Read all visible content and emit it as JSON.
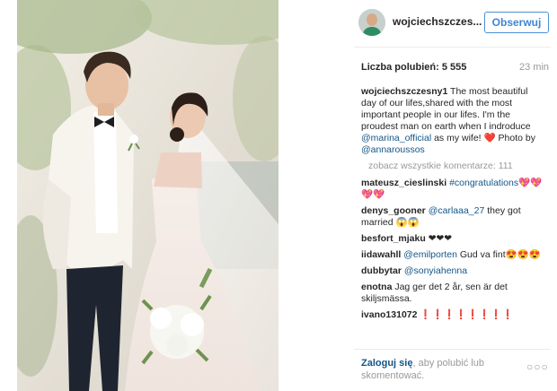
{
  "post": {
    "username": "wojciechszczes...",
    "follow_label": "Obserwuj",
    "likes": "Liczba polubień: 5 555",
    "time": "23 min"
  },
  "caption": {
    "user": "wojciechszczesny1",
    "text_1": " The most beautiful day of our lifes,shared with the most important people in our lifes. I'm the proudest man on earth when I indroduce ",
    "mention_1": "@marina_official",
    "text_2": " as my wife! ",
    "heart": "❤️",
    "text_3": " Photo by ",
    "mention_2": "@annaroussos"
  },
  "more_comments": "zobacz wszystkie komentarze: 111",
  "comments": [
    {
      "user": "mateusz_cieslinski",
      "mention": "#congratulations",
      "text": "",
      "emoji": "💖💖💖💖"
    },
    {
      "user": "denys_gooner",
      "mention": "@carlaaa_27",
      "text": " they got married ",
      "emoji": "😱😱"
    },
    {
      "user": "besfort_mjaku",
      "mention": "",
      "text": " ❤❤❤",
      "emoji": ""
    },
    {
      "user": "iidawahll",
      "mention": "@emilporten",
      "text": " Gud va fint",
      "emoji": "😍😍😍"
    },
    {
      "user": "dubbytar",
      "mention": "@sonyiahenna",
      "text": "",
      "emoji": ""
    },
    {
      "user": "enotna",
      "mention": "",
      "text": " Jag ger det 2 år, sen är det skiljsmässa.",
      "emoji": ""
    },
    {
      "user": "ivano131072",
      "mention": "",
      "text": " ❗❗❗❗❗❗❗❗",
      "emoji": ""
    }
  ],
  "footer": {
    "login_link": "Zaloguj się",
    "login_rest": ", aby polubić lub skomentować.",
    "options": "○○○"
  },
  "colors": {
    "link": "#125688",
    "follow_border": "#4a90d9",
    "muted": "#999999"
  }
}
